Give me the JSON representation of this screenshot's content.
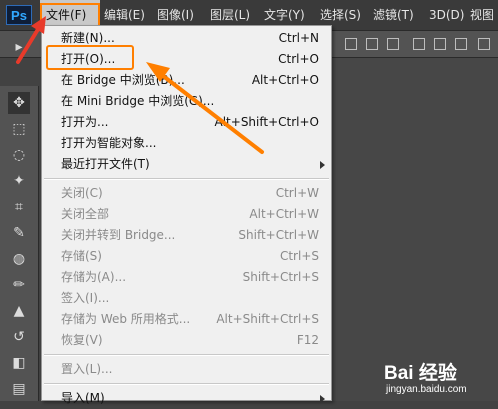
{
  "app": {
    "logo": "Ps",
    "menubar": [
      {
        "label": "文件(F)",
        "active": true
      },
      {
        "label": "编辑(E)"
      },
      {
        "label": "图像(I)"
      },
      {
        "label": "图层(L)"
      },
      {
        "label": "文字(Y)"
      },
      {
        "label": "选择(S)"
      },
      {
        "label": "滤镜(T)"
      },
      {
        "label": "3D(D)"
      },
      {
        "label": "视图"
      }
    ]
  },
  "file_menu": {
    "items": [
      {
        "label": "新建(N)...",
        "shortcut": "Ctrl+N",
        "enabled": true
      },
      {
        "label": "打开(O)...",
        "shortcut": "Ctrl+O",
        "enabled": true,
        "highlighted": true
      },
      {
        "label": "在 Bridge 中浏览(B)...",
        "shortcut": "Alt+Ctrl+O",
        "enabled": true
      },
      {
        "label": "在 Mini Bridge 中浏览(G)...",
        "shortcut": "",
        "enabled": true
      },
      {
        "label": "打开为...",
        "shortcut": "Alt+Shift+Ctrl+O",
        "enabled": true
      },
      {
        "label": "打开为智能对象...",
        "shortcut": "",
        "enabled": true
      },
      {
        "label": "最近打开文件(T)",
        "shortcut": "",
        "enabled": true,
        "submenu": true
      },
      {
        "label": "关闭(C)",
        "shortcut": "Ctrl+W",
        "enabled": false
      },
      {
        "label": "关闭全部",
        "shortcut": "Alt+Ctrl+W",
        "enabled": false
      },
      {
        "label": "关闭并转到 Bridge...",
        "shortcut": "Shift+Ctrl+W",
        "enabled": false
      },
      {
        "label": "存储(S)",
        "shortcut": "Ctrl+S",
        "enabled": false
      },
      {
        "label": "存储为(A)...",
        "shortcut": "Shift+Ctrl+S",
        "enabled": false
      },
      {
        "label": "签入(I)...",
        "shortcut": "",
        "enabled": false
      },
      {
        "label": "存储为 Web 所用格式...",
        "shortcut": "Alt+Shift+Ctrl+S",
        "enabled": false
      },
      {
        "label": "恢复(V)",
        "shortcut": "F12",
        "enabled": false
      },
      {
        "label": "置入(L)...",
        "shortcut": "",
        "enabled": false
      },
      {
        "label": "导入(M)",
        "shortcut": "",
        "enabled": true,
        "submenu": true
      }
    ]
  },
  "colors": {
    "accent": "#ff7f00",
    "menu_bg": "#f0f0f0",
    "menubar_bg": "#3a3a3a"
  },
  "icons": [
    "move-tool-icon",
    "marquee-tool-icon",
    "lasso-tool-icon",
    "magic-wand-icon",
    "crop-tool-icon",
    "eyedropper-icon",
    "healing-brush-icon",
    "brush-tool-icon",
    "clone-stamp-icon",
    "history-brush-icon",
    "eraser-icon",
    "gradient-tool-icon"
  ],
  "watermark": {
    "brand": "Bai 经验",
    "url": "jingyan.baidu.com"
  }
}
